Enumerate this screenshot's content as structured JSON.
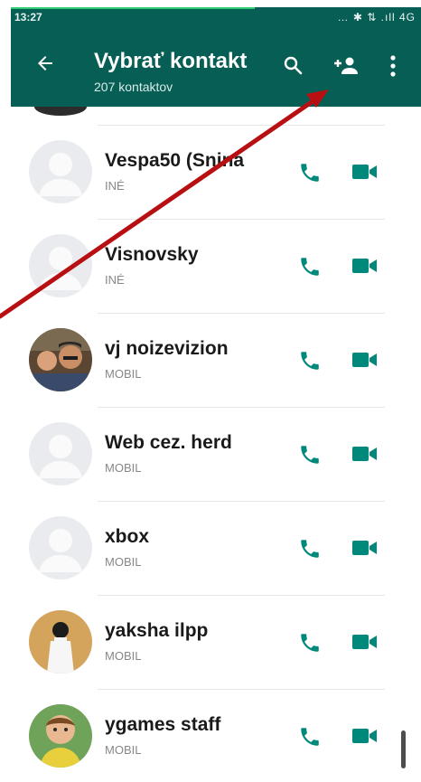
{
  "statusbar": {
    "time": "13:27",
    "icons_text": "… ✱ ⇅ .ıll 4G"
  },
  "appbar": {
    "title": "Vybrať kontakt",
    "subtitle": "207 kontaktov"
  },
  "icons": {
    "back": "back-arrow-icon",
    "search": "search-icon",
    "add_contact": "add-contact-icon",
    "more": "more-vert-icon",
    "call": "phone-icon",
    "video": "video-camera-icon"
  },
  "colors": {
    "primary": "#075e54",
    "accent": "#00897b",
    "annotation_arrow": "#b80f12"
  },
  "contacts": [
    {
      "name": "Vespa50 (Snina",
      "type": "INÉ",
      "avatar": "default"
    },
    {
      "name": "Visnovsky",
      "type": "INÉ",
      "avatar": "default"
    },
    {
      "name": "vj noizevizion",
      "type": "MOBIL",
      "avatar": "photo"
    },
    {
      "name": "Web cez. herd",
      "type": "MOBIL",
      "avatar": "default"
    },
    {
      "name": "xbox",
      "type": "MOBIL",
      "avatar": "default"
    },
    {
      "name": "yaksha ilpp",
      "type": "MOBIL",
      "avatar": "photo"
    },
    {
      "name": "ygames staff",
      "type": "MOBIL",
      "avatar": "photo"
    }
  ]
}
